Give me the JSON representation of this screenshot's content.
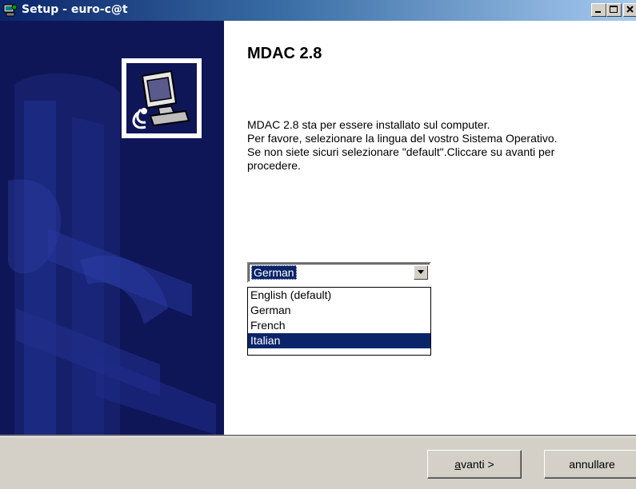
{
  "window": {
    "title": "Setup - euro-c@t"
  },
  "content": {
    "heading": "MDAC 2.8",
    "description": "MDAC 2.8 sta per essere installato sul computer.\nPer favore, selezionare la lingua del vostro Sistema Operativo.\nSe non siete sicuri selezionare \"default\".Cliccare su avanti per\nprocedere."
  },
  "language_select": {
    "value": "German",
    "options": [
      "English (default)",
      "German",
      "French",
      "Italian"
    ],
    "highlighted_option": "Italian"
  },
  "buttons": {
    "next_mnemonic": "a",
    "next_rest": "vanti >",
    "cancel": "annullare"
  },
  "icons": {
    "title": "setup-app-icon",
    "banner": "computer-install-icon",
    "dropdown": "chevron-down-icon"
  },
  "colors": {
    "banner_background": "#0f1657",
    "selection": "#0a246a",
    "dialog_face": "#d4d0c8"
  }
}
